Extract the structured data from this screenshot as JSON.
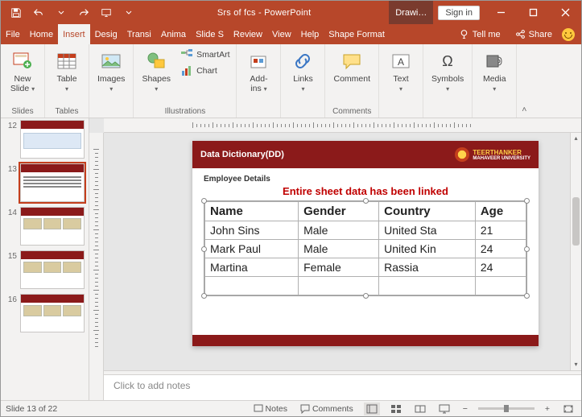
{
  "titlebar": {
    "doc_title": "Srs of fcs  -  PowerPoint",
    "context_tab": "Drawi…",
    "signin": "Sign in"
  },
  "tabs": {
    "items": [
      "File",
      "Home",
      "Insert",
      "Design",
      "Transitions",
      "Animations",
      "Slide Show",
      "Review",
      "View",
      "Help",
      "Shape Format"
    ],
    "display": [
      "File",
      "Home",
      "Insert",
      "Desig",
      "Transi",
      "Anima",
      "Slide S",
      "Review",
      "View",
      "Help",
      "Shape Format"
    ],
    "active_index": 2,
    "tellme": "Tell me",
    "share": "Share"
  },
  "ribbon": {
    "new_slide": "New\nSlide",
    "table": "Table",
    "images": "Images",
    "shapes": "Shapes",
    "smartart": "SmartArt",
    "chart": "Chart",
    "addins": "Add-\nins",
    "links": "Links",
    "comment": "Comment",
    "text": "Text",
    "symbols": "Symbols",
    "media": "Media",
    "groups": {
      "slides": "Slides",
      "tables": "Tables",
      "illustrations": "Illustrations",
      "comments": "Comments"
    }
  },
  "thumbs": {
    "numbers": [
      "12",
      "13",
      "14",
      "15",
      "16"
    ],
    "selected_index": 1
  },
  "slide": {
    "header": "Data Dictionary(DD)",
    "uni_line1": "TEERTHANKER",
    "uni_line2": "MAHAVEER UNIVERSITY",
    "uni_badge": "TMU",
    "section_title": "Employee Details",
    "linked_msg": "Entire sheet data has been linked",
    "table": {
      "headers": [
        "Name",
        "Gender",
        "Country",
        "Age"
      ],
      "rows": [
        [
          "John Sins",
          "Male",
          "United Sta",
          "21"
        ],
        [
          "Mark Paul",
          "Male",
          "United Kin",
          "24"
        ],
        [
          "Martina",
          "Female",
          "Rassia",
          "24"
        ]
      ]
    }
  },
  "notes_placeholder": "Click to add notes",
  "statusbar": {
    "slide_info": "Slide 13 of 22",
    "notes": "Notes",
    "comments": "Comments"
  }
}
